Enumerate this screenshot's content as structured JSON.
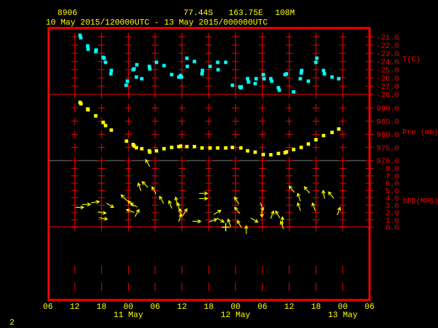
{
  "header": {
    "station": "8906",
    "latitude": "77.44S",
    "longitude": "163.75E",
    "elevation": "108M",
    "period": "10 May 2015/120000UTC - 13 May 2015/000000UTC"
  },
  "footer": {
    "page": "2"
  },
  "colors": {
    "frame": "#ff0000",
    "temperature": "#00ffff",
    "pressure": "#ffff00",
    "wind": "#ffff00",
    "text": "#ffff00"
  },
  "chart_data": [
    {
      "type": "scatter",
      "title": "T(C)",
      "ylabel": "T(C)",
      "ylim": [
        -28,
        -21
      ],
      "yticks": [
        "-21.0",
        "-22.0",
        "-23.0",
        "-24.0",
        "-25.0",
        "-26.0",
        "-27.0",
        "-28.0"
      ],
      "x_units": "hours since 10 May 06UTC",
      "points": [
        [
          7.2,
          -20.8
        ],
        [
          7.35,
          -21.1
        ],
        [
          8.9,
          -22.1
        ],
        [
          9.0,
          -22.5
        ],
        [
          10.8,
          -22.6
        ],
        [
          10.7,
          -22.8
        ],
        [
          12.4,
          -23.5
        ],
        [
          12.6,
          -23.6
        ],
        [
          12.9,
          -24.1
        ],
        [
          14.2,
          -25.1
        ],
        [
          14.1,
          -25.5
        ],
        [
          17.8,
          -26.4
        ],
        [
          17.5,
          -26.9
        ],
        [
          19.3,
          -24.9
        ],
        [
          19.1,
          -25.0
        ],
        [
          19.9,
          -24.4
        ],
        [
          19.8,
          -25.9
        ],
        [
          21.0,
          -26.1
        ],
        [
          22.7,
          -24.6
        ],
        [
          22.8,
          -24.9
        ],
        [
          24.3,
          -24.1
        ],
        [
          26.0,
          -24.5
        ],
        [
          27.7,
          -25.6
        ],
        [
          29.7,
          -25.7
        ],
        [
          29.3,
          -25.9
        ],
        [
          29.9,
          -25.9
        ],
        [
          31.1,
          -23.6
        ],
        [
          31.2,
          -24.6
        ],
        [
          32.8,
          -24.0
        ],
        [
          34.6,
          -25.1
        ],
        [
          34.5,
          -25.5
        ],
        [
          36.3,
          -24.6
        ],
        [
          38.0,
          -24.1
        ],
        [
          38.1,
          -25.0
        ],
        [
          39.8,
          -24.1
        ],
        [
          41.3,
          -26.9
        ],
        [
          43.0,
          -27.1
        ],
        [
          43.3,
          -27.1
        ],
        [
          43.2,
          -27.2
        ],
        [
          44.7,
          -26.1
        ],
        [
          44.9,
          -26.5
        ],
        [
          46.4,
          -26.7
        ],
        [
          46.6,
          -26.1
        ],
        [
          48.2,
          -25.6
        ],
        [
          48.4,
          -26.1
        ],
        [
          49.9,
          -26.1
        ],
        [
          50.1,
          -26.4
        ],
        [
          51.6,
          -27.2
        ],
        [
          51.8,
          -27.5
        ],
        [
          53.1,
          -25.6
        ],
        [
          53.4,
          -25.5
        ],
        [
          55.0,
          -27.7
        ],
        [
          56.5,
          -26.1
        ],
        [
          56.7,
          -25.4
        ],
        [
          56.8,
          -25.1
        ],
        [
          58.3,
          -26.4
        ],
        [
          60.0,
          -24.1
        ],
        [
          60.2,
          -23.6
        ],
        [
          61.7,
          -25.1
        ],
        [
          61.9,
          -25.5
        ],
        [
          63.6,
          -25.9
        ],
        [
          65.1,
          -26.1
        ]
      ]
    },
    {
      "type": "scatter",
      "title": "Pre (mb)",
      "ylabel": "Pre (mb)",
      "ylim": [
        970,
        990
      ],
      "yticks": [
        "990.0",
        "985.0",
        "980.0",
        "975.0",
        "970.0"
      ],
      "points": [
        [
          7.2,
          992.1
        ],
        [
          7.4,
          991.6
        ],
        [
          8.9,
          989.6
        ],
        [
          9.0,
          989.3
        ],
        [
          10.7,
          987.0
        ],
        [
          12.4,
          984.5
        ],
        [
          12.9,
          983.3
        ],
        [
          14.2,
          981.6
        ],
        [
          17.6,
          977.4
        ],
        [
          19.1,
          976.1
        ],
        [
          19.3,
          975.5
        ],
        [
          19.8,
          974.9
        ],
        [
          21.0,
          974.5
        ],
        [
          22.7,
          973.7
        ],
        [
          22.8,
          973.2
        ],
        [
          24.3,
          973.7
        ],
        [
          26.0,
          974.5
        ],
        [
          27.7,
          975.0
        ],
        [
          29.3,
          975.3
        ],
        [
          29.7,
          975.5
        ],
        [
          31.1,
          975.3
        ],
        [
          32.8,
          975.3
        ],
        [
          34.5,
          974.8
        ],
        [
          36.3,
          974.8
        ],
        [
          38.0,
          974.8
        ],
        [
          39.8,
          974.8
        ],
        [
          41.3,
          975.0
        ],
        [
          43.2,
          974.8
        ],
        [
          44.7,
          973.7
        ],
        [
          46.4,
          973.2
        ],
        [
          48.2,
          972.3
        ],
        [
          49.9,
          972.2
        ],
        [
          51.6,
          972.7
        ],
        [
          53.1,
          973.0
        ],
        [
          53.4,
          973.3
        ],
        [
          55.0,
          974.2
        ],
        [
          56.7,
          975.0
        ],
        [
          58.3,
          976.3
        ],
        [
          60.0,
          977.9
        ],
        [
          61.7,
          979.5
        ],
        [
          63.6,
          980.7
        ],
        [
          65.1,
          982.0
        ]
      ]
    },
    {
      "type": "scatter",
      "title": "SPD(MPS)",
      "ylabel": "SPD(MPS)",
      "ylim": [
        0,
        8
      ],
      "yticks": [
        "8.0",
        "7.0",
        "6.0",
        "5.0",
        "4.0",
        "3.0",
        "2.0",
        "1.0",
        "0.0"
      ],
      "note": "points are [hour, speed, arrow direction degrees]",
      "points": [
        [
          8.0,
          2.7,
          90
        ],
        [
          9.5,
          3.1,
          90
        ],
        [
          11.5,
          3.5,
          80
        ],
        [
          14.7,
          2.7,
          120
        ],
        [
          13.0,
          1.9,
          100
        ],
        [
          13.3,
          1.1,
          100
        ],
        [
          16.4,
          4.4,
          315
        ],
        [
          17.9,
          3.6,
          315
        ],
        [
          18.4,
          3.3,
          300
        ],
        [
          17.6,
          2.4,
          290
        ],
        [
          20.4,
          2.4,
          30
        ],
        [
          20.2,
          6.0,
          340
        ],
        [
          21.1,
          6.2,
          315
        ],
        [
          23.3,
          5.5,
          330
        ],
        [
          21.9,
          9.2,
          330
        ],
        [
          25.0,
          4.2,
          330
        ],
        [
          27.1,
          3.6,
          340
        ],
        [
          28.6,
          4.1,
          350
        ],
        [
          29.1,
          3.3,
          350
        ],
        [
          29.6,
          2.5,
          0
        ],
        [
          31.1,
          2.5,
          30
        ],
        [
          29.9,
          1.8,
          20
        ],
        [
          34.2,
          0.8,
          90
        ],
        [
          35.7,
          4.6,
          90
        ],
        [
          35.7,
          3.9,
          90
        ],
        [
          38.7,
          2.3,
          60
        ],
        [
          37.8,
          1.1,
          70
        ],
        [
          39.4,
          0.7,
          120
        ],
        [
          39.8,
          0.0,
          0
        ],
        [
          40.3,
          1.1,
          340
        ],
        [
          41.8,
          4.1,
          330
        ],
        [
          41.8,
          2.7,
          320
        ],
        [
          42.4,
          0.9,
          330
        ],
        [
          44.4,
          0.2,
          0
        ],
        [
          47.0,
          0.7,
          120
        ],
        [
          48.2,
          2.3,
          160
        ],
        [
          47.9,
          1.4,
          180
        ],
        [
          50.5,
          2.2,
          20
        ],
        [
          51.0,
          2.2,
          330
        ],
        [
          52.5,
          1.4,
          0
        ],
        [
          52.1,
          0.8,
          340
        ],
        [
          54.0,
          5.6,
          320
        ],
        [
          55.9,
          4.6,
          340
        ],
        [
          55.9,
          3.3,
          340
        ],
        [
          57.4,
          5.5,
          320
        ],
        [
          59.2,
          3.3,
          340
        ],
        [
          61.6,
          5.0,
          350
        ],
        [
          62.8,
          4.8,
          320
        ],
        [
          65.4,
          2.7,
          20
        ]
      ]
    }
  ],
  "xaxis": {
    "range_hours": [
      0,
      72
    ],
    "ticks": [
      "06",
      "12",
      "18",
      "00",
      "06",
      "12",
      "18",
      "00",
      "06",
      "12",
      "18",
      "00",
      "06"
    ],
    "days": [
      {
        "label": "11 May",
        "hour": 18
      },
      {
        "label": "12 May",
        "hour": 42
      },
      {
        "label": "13 May",
        "hour": 66
      }
    ]
  }
}
